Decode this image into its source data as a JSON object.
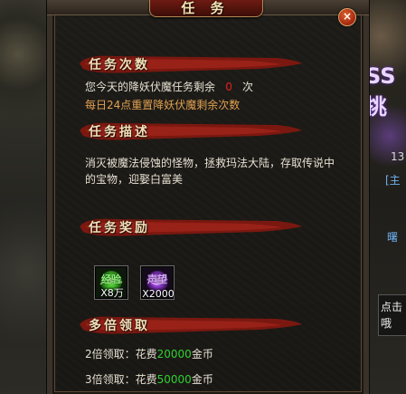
{
  "window": {
    "title": "任 务",
    "close_label": "×"
  },
  "background": {
    "boss_text": "SS挑",
    "hint_text": "点击 哦",
    "side_number": "13",
    "side_bracket": "[主",
    "side_blue": "曙"
  },
  "sections": {
    "count": {
      "heading": "任务次数",
      "remaining_prefix": "您今天的降妖伏魔任务剩余",
      "remaining_value": "0",
      "remaining_suffix": "次",
      "reset_note": "每日24点重置降妖伏魔剩余次数"
    },
    "description": {
      "heading": "任务描述",
      "body": "消灭被魔法侵蚀的怪物，拯救玛法大陆，存取传说中的宝物，迎娶白富美"
    },
    "rewards": {
      "heading": "任务奖励",
      "items": [
        {
          "name": "经验",
          "count": "X8万",
          "icon": "exp-orb-icon",
          "color": "#6de04a"
        },
        {
          "name": "声望",
          "count": "X2000",
          "icon": "prestige-orb-icon",
          "color": "#b35cf0"
        }
      ]
    },
    "multi": {
      "heading": "多倍领取",
      "options": [
        {
          "prefix": "2倍领取：花费",
          "amount": "20000",
          "suffix": "金币"
        },
        {
          "prefix": "3倍领取：花费",
          "amount": "50000",
          "suffix": "金币"
        }
      ]
    }
  },
  "colors": {
    "accent_red": "#e02020",
    "amount_green": "#2fd12f",
    "note_orange": "#e0a050",
    "heading_brush": "#8a1a12"
  }
}
